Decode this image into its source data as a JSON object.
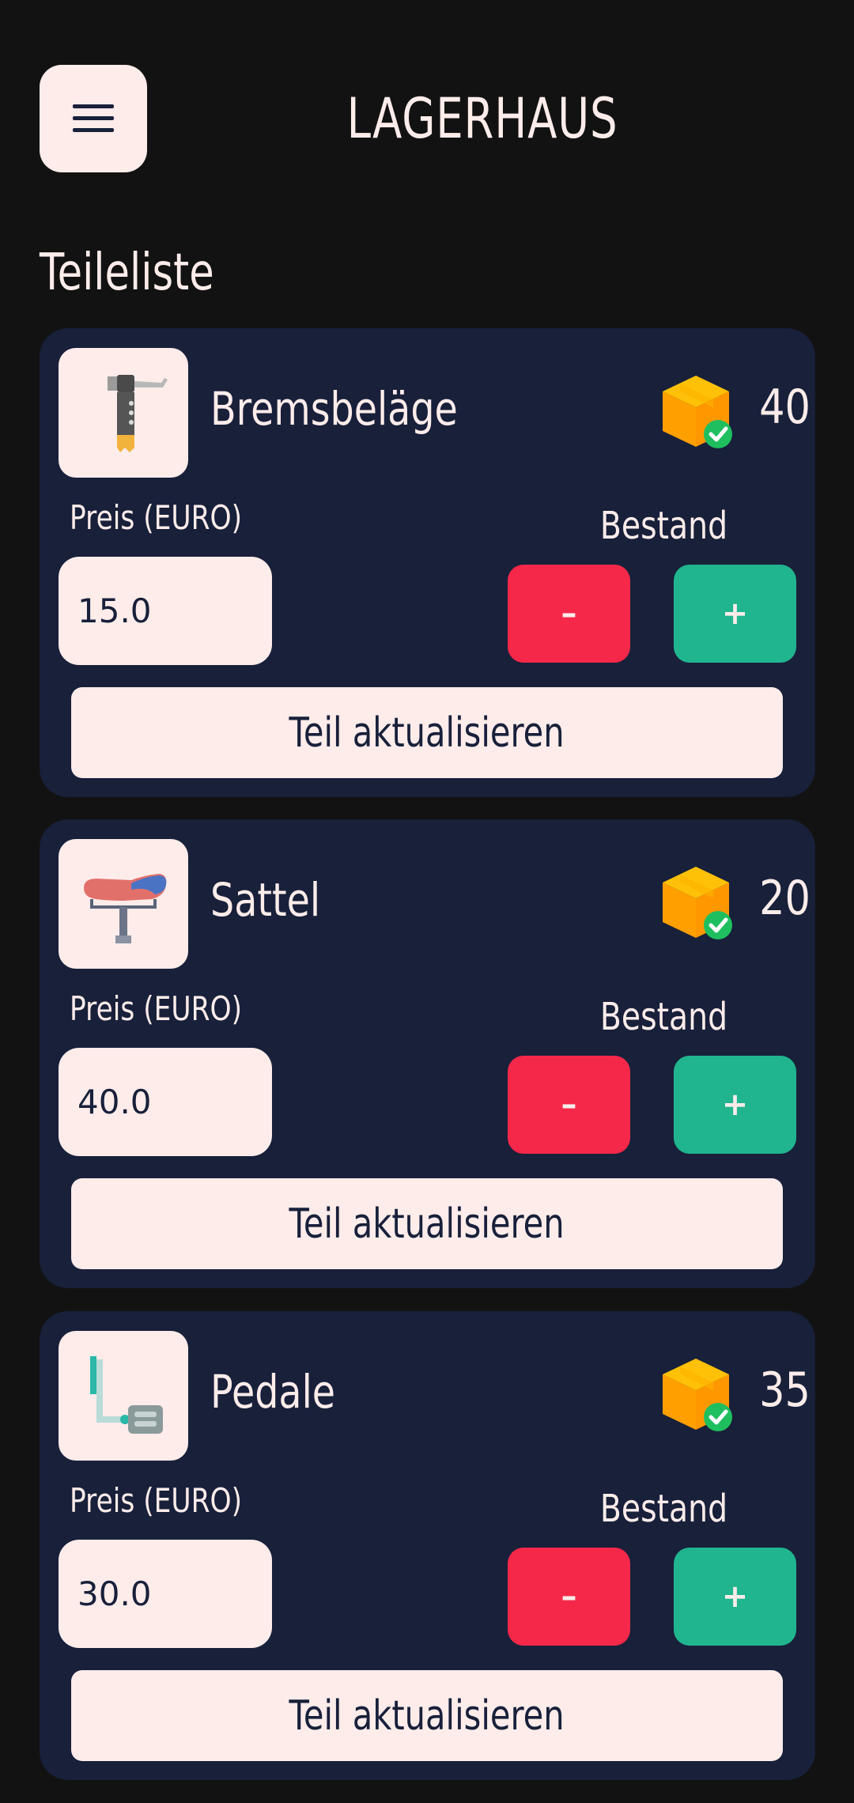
{
  "header": {
    "title": "LAGERHAUS",
    "menu_icon": "hamburger-menu-icon"
  },
  "section": {
    "title": "Teileliste"
  },
  "colors": {
    "background": "#121212",
    "card": "#18203a",
    "light": "#fdecea",
    "minus": "#f5284a",
    "plus": "#20b58e"
  },
  "parts": [
    {
      "name": "Bremsbeläge",
      "icon": "brake-lever-icon",
      "stock": "40",
      "price_label": "Preis (EURO)",
      "price": "15.0",
      "stock_label": "Bestand",
      "minus_label": "–",
      "plus_label": "+",
      "update_label": "Teil aktualisieren"
    },
    {
      "name": "Sattel",
      "icon": "bike-saddle-icon",
      "stock": "20",
      "price_label": "Preis (EURO)",
      "price": "40.0",
      "stock_label": "Bestand",
      "minus_label": "–",
      "plus_label": "+",
      "update_label": "Teil aktualisieren"
    },
    {
      "name": "Pedale",
      "icon": "bike-pedal-icon",
      "stock": "35",
      "price_label": "Preis (EURO)",
      "price": "30.0",
      "stock_label": "Bestand",
      "minus_label": "–",
      "plus_label": "+",
      "update_label": "Teil aktualisieren"
    }
  ]
}
